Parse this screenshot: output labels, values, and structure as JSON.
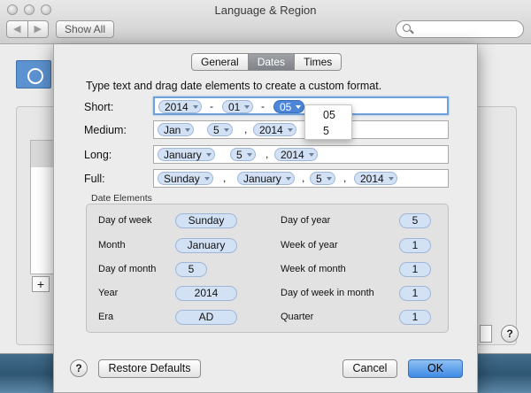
{
  "window": {
    "title": "Language & Region",
    "show_all": "Show All",
    "back_glyph": "◀",
    "forward_glyph": "▶"
  },
  "tabs": [
    {
      "label": "General",
      "active": false
    },
    {
      "label": "Dates",
      "active": true
    },
    {
      "label": "Times",
      "active": false
    }
  ],
  "instructions": "Type text and drag date elements to create a custom format.",
  "formats": {
    "short": {
      "label": "Short:",
      "tokens": [
        "2014",
        "01",
        "05"
      ],
      "separators": [
        "-",
        "-"
      ]
    },
    "medium": {
      "label": "Medium:",
      "tokens": [
        "Jan",
        "5",
        "2014"
      ],
      "separators": [
        ",",
        ","
      ]
    },
    "long": {
      "label": "Long:",
      "tokens": [
        "January",
        "5",
        "2014"
      ],
      "separators": [
        ",",
        ","
      ]
    },
    "full": {
      "label": "Full:",
      "tokens": [
        "Sunday",
        "January",
        "5",
        "2014"
      ],
      "separators": [
        ",",
        ",",
        ","
      ]
    }
  },
  "popup_options": [
    "05",
    "5"
  ],
  "date_elements": {
    "title": "Date Elements",
    "left": [
      {
        "label": "Day of week",
        "value": "Sunday"
      },
      {
        "label": "Month",
        "value": "January"
      },
      {
        "label": "Day of month",
        "value": "5"
      },
      {
        "label": "Year",
        "value": "2014"
      },
      {
        "label": "Era",
        "value": "AD"
      }
    ],
    "right": [
      {
        "label": "Day of year",
        "value": "5"
      },
      {
        "label": "Week of year",
        "value": "1"
      },
      {
        "label": "Week of month",
        "value": "1"
      },
      {
        "label": "Day of week in month",
        "value": "1"
      },
      {
        "label": "Quarter",
        "value": "1"
      }
    ]
  },
  "buttons": {
    "help": "?",
    "restore": "Restore Defaults",
    "cancel": "Cancel",
    "ok": "OK",
    "plus": "+"
  },
  "colors": {
    "accent": "#4d86d9",
    "token_fill": "#d3e1f5"
  }
}
